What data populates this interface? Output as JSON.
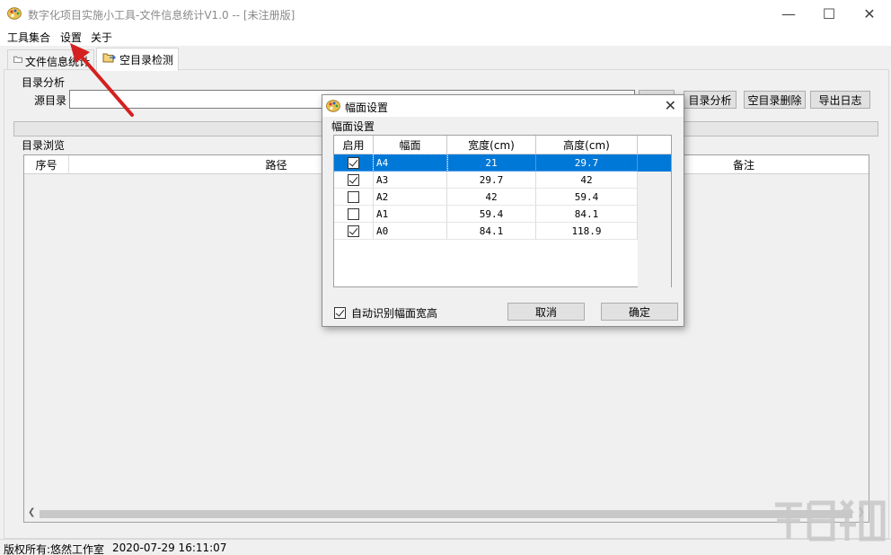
{
  "window": {
    "title": "数字化项目实施小工具-文件信息统计V1.0 -- [未注册版]",
    "minimize_glyph": "—",
    "maximize_glyph": "☐",
    "close_glyph": "✕"
  },
  "menu": {
    "items": [
      "工具集合",
      "设置",
      "关于"
    ]
  },
  "tabs": [
    {
      "label": "文件信息统计"
    },
    {
      "label": "空目录检测"
    }
  ],
  "dir_analysis": {
    "group_label": "目录分析",
    "source_label": "源目录",
    "source_value": "",
    "analyze_button": "目录分析",
    "delete_empty_button": "空目录删除",
    "export_log_button": "导出日志"
  },
  "browse": {
    "group_label": "目录浏览",
    "columns": [
      "序号",
      "路径",
      "备注"
    ]
  },
  "status": {
    "copyright": "版权所有:悠然工作室",
    "datetime": "2020-07-29 16:11:07"
  },
  "dialog": {
    "title": "幅面设置",
    "group_label": "幅面设置",
    "columns": [
      "启用",
      "幅面",
      "宽度(cm)",
      "高度(cm)"
    ],
    "rows": [
      {
        "enabled": true,
        "name": "A4",
        "width": "21",
        "height": "29.7",
        "selected": true
      },
      {
        "enabled": true,
        "name": "A3",
        "width": "29.7",
        "height": "42",
        "selected": false
      },
      {
        "enabled": false,
        "name": "A2",
        "width": "42",
        "height": "59.4",
        "selected": false
      },
      {
        "enabled": false,
        "name": "A1",
        "width": "59.4",
        "height": "84.1",
        "selected": false
      },
      {
        "enabled": true,
        "name": "A0",
        "width": "84.1",
        "height": "118.9",
        "selected": false
      }
    ],
    "auto_detect_label": "自动识别幅面宽高",
    "auto_detect_checked": true,
    "cancel_button": "取消",
    "ok_button": "确定"
  },
  "colors": {
    "selection": "#0078d7",
    "arrow": "#d42020"
  }
}
